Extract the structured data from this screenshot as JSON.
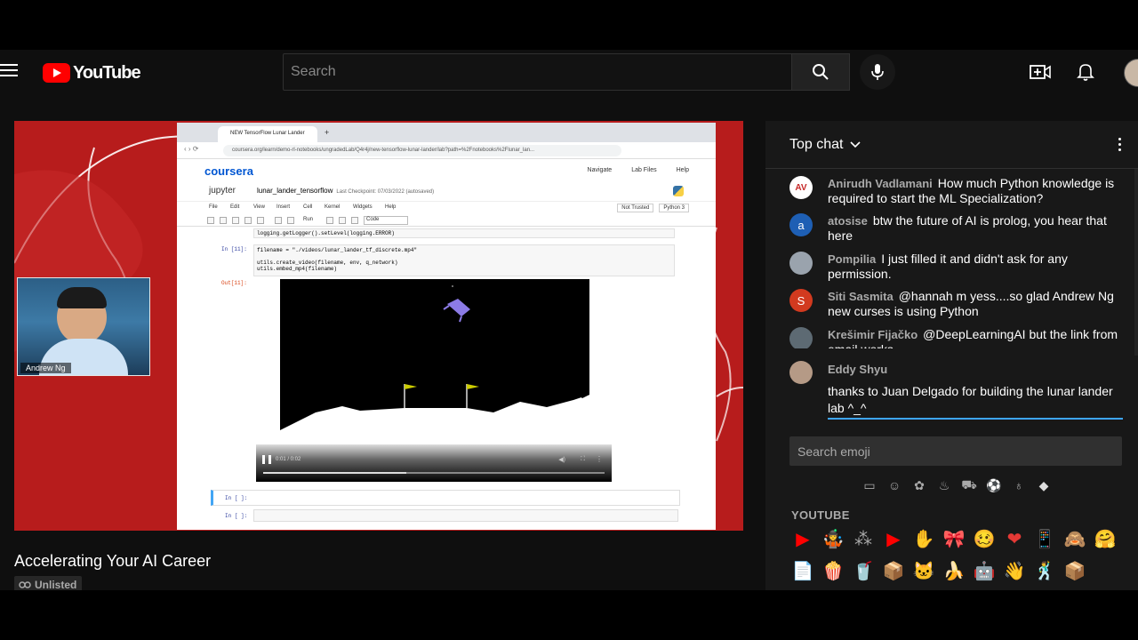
{
  "masthead": {
    "logo_text": "YouTube",
    "search_placeholder": "Search"
  },
  "player": {
    "webcam_name": "Andrew Ng",
    "browser_tab_title": "NEW TensorFlow Lunar Lander",
    "browser_url": "coursera.org/learn/demo-rl-notebooks/ungradedLab/Q4r4j/new-tensorflow-lunar-lander/lab?path=%2Fnotebooks%2Flunar_lan...",
    "coursera_logo": "coursera",
    "coursera_links": [
      "Navigate",
      "Lab Files",
      "Help"
    ],
    "jupyter_label": "jupyter",
    "notebook_title": "lunar_lander_tensorflow",
    "checkpoint": "Last Checkpoint: 07/03/2022  (autosaved)",
    "menu": [
      "File",
      "Edit",
      "View",
      "Insert",
      "Cell",
      "Kernel",
      "Widgets",
      "Help"
    ],
    "trust_badge": "Not Trusted",
    "kernel_badge": "Python 3",
    "toolbar_run": "Run",
    "toolbar_celltype": "Code",
    "code_top": "logging.getLogger().setLevel(logging.ERROR)",
    "prompt_in_11": "In [11]:",
    "code_cell": "filename = \"./videos/lunar_lander_tf_discrete.mp4\"\n\nutils.create_video(filename, env, q_network)\nutils.embed_mp4(filename)",
    "prompt_out_11": "Out[11]:",
    "video_time": "0:01 / 0:02",
    "prompt_empty_1": "In [ ]:",
    "prompt_empty_2": "In [ ]:"
  },
  "video": {
    "title": "Accelerating Your AI Career",
    "visibility": "Unlisted"
  },
  "chat": {
    "mode_label": "Top chat",
    "messages": [
      {
        "author": "Anirudh Vadlamani",
        "text": "How much Python knowledge is required to start the ML Specialization?",
        "avatar_letter": "AV",
        "avatar_color": "#ffffff"
      },
      {
        "author": "atosise",
        "text": "btw the future of AI is prolog, you hear that here",
        "avatar_letter": "a",
        "avatar_color": "#1e5fb4"
      },
      {
        "author": "Pompilia",
        "text": "I just filled it and didn't ask for any permission.",
        "avatar_letter": "",
        "avatar_color": "#9aa3ad"
      },
      {
        "author": "Siti Sasmita",
        "text": "@hannah m yess....so glad Andrew Ng new curses is using Python",
        "avatar_letter": "S",
        "avatar_color": "#d23a1f"
      },
      {
        "author": "Krešimir Fijačko",
        "text": "@DeepLearningAI but the link from email works",
        "avatar_letter": "",
        "avatar_color": "#5d6a73"
      }
    ],
    "compose": {
      "author": "Eddy Shyu",
      "text": "thanks to Juan Delgado for building the lunar lander lab ^_^"
    },
    "emoji_search_placeholder": "Search emoji",
    "emoji_section": "YOUTUBE",
    "emoji_categories": [
      "youtube-icon",
      "smiley-icon",
      "nature-icon",
      "food-icon",
      "travel-icon",
      "activity-icon",
      "objects-icon",
      "symbols-icon"
    ],
    "emojis": [
      "▶",
      "🤹",
      "⁂",
      "▶",
      "✋",
      "🎀",
      "🥴",
      "❤",
      "📱",
      "🙈",
      "🤗",
      "📄",
      "🍿",
      "🥤",
      "📦",
      "🐱",
      "🍌",
      "🤖",
      "👋",
      "🕺",
      "📦"
    ]
  }
}
